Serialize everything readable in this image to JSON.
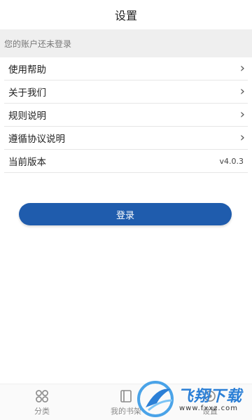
{
  "header": {
    "title": "设置"
  },
  "account": {
    "status_text": "您的账户还未登录"
  },
  "menu": {
    "items": [
      {
        "label": "使用帮助",
        "icon": "chevron-right-icon"
      },
      {
        "label": "关于我们",
        "icon": "chevron-right-icon"
      },
      {
        "label": "规则说明",
        "icon": "chevron-right-icon"
      },
      {
        "label": "遵循协议说明",
        "icon": "chevron-right-icon"
      }
    ],
    "version_label": "当前版本",
    "version_value": "v4.0.3",
    "chevron_glyph": "›"
  },
  "login": {
    "button_label": "登录",
    "color": "#1f5cad"
  },
  "tabbar": {
    "tabs": [
      {
        "label": "分类",
        "icon": "grid-icon"
      },
      {
        "label": "我的书架",
        "icon": "bookshelf-icon"
      },
      {
        "label": "设置",
        "icon": "settings-icon"
      }
    ]
  },
  "watermark": {
    "title": "飞翔下载",
    "url": "www.fxxz.com"
  }
}
